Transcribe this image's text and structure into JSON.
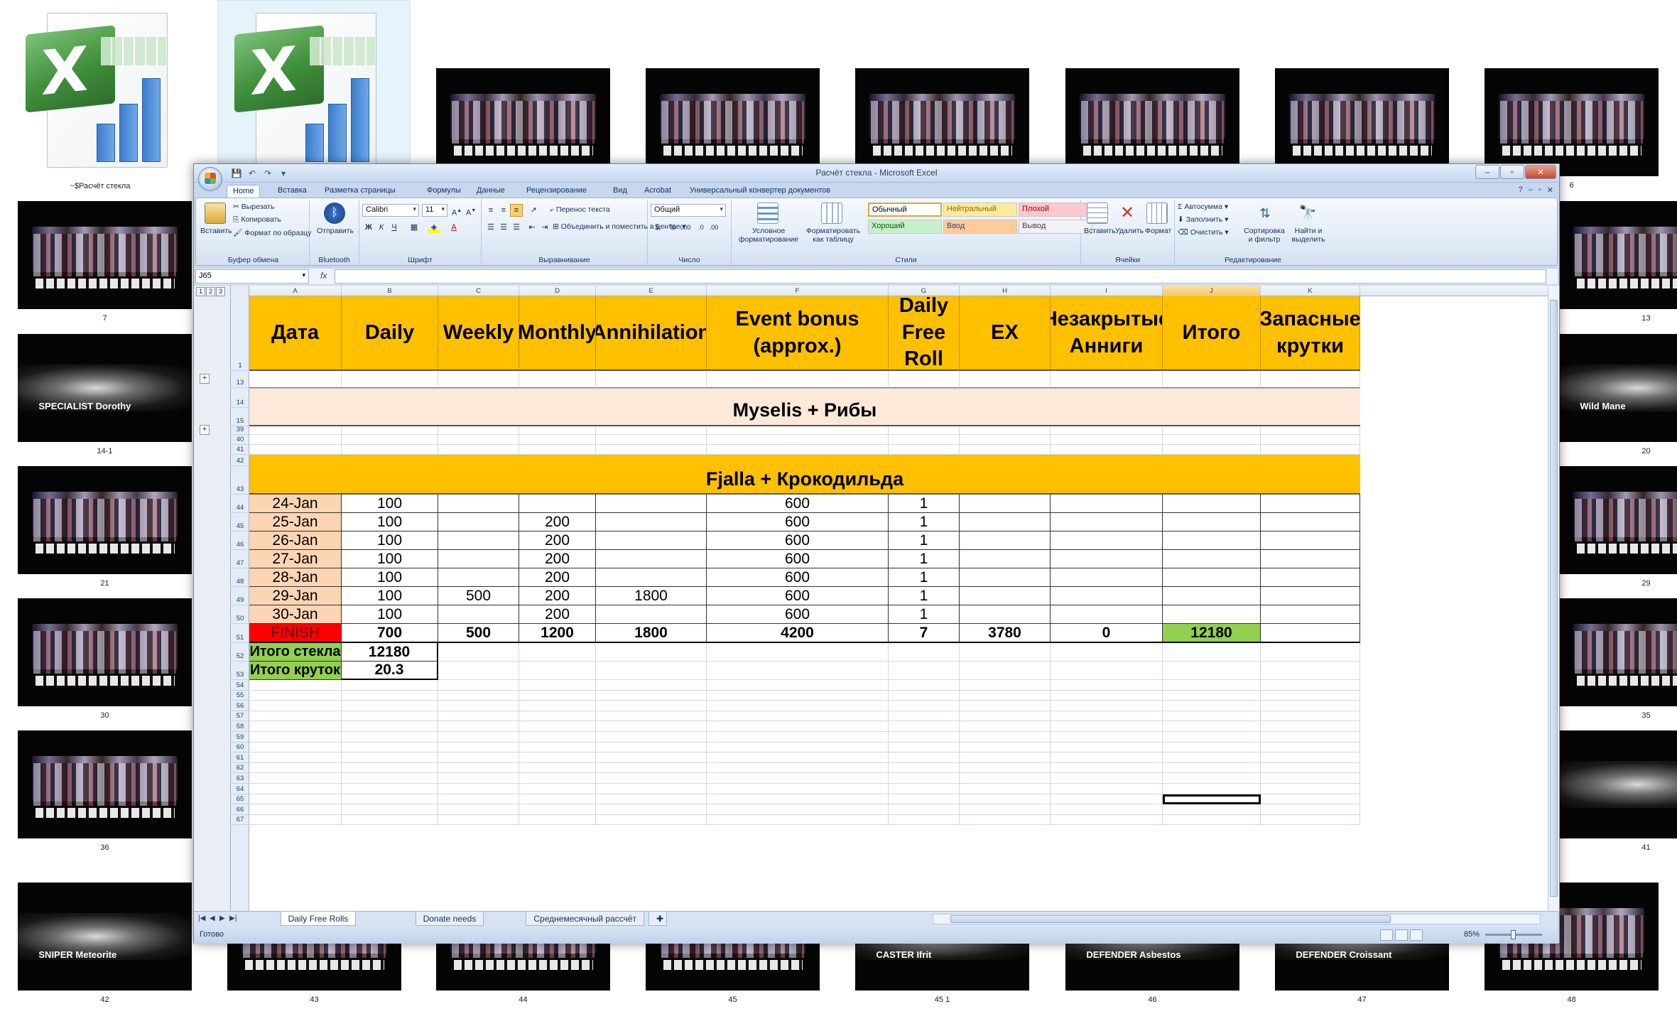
{
  "desktop": {
    "excel_files": [
      {
        "caption": "~$Расчёт стекла"
      },
      {
        "caption": ""
      }
    ],
    "thumbnails": [
      {
        "caption": "",
        "kind": "roster"
      },
      {
        "caption": "",
        "kind": "roster"
      },
      {
        "caption": "",
        "kind": "roster"
      },
      {
        "caption": "",
        "kind": "roster"
      },
      {
        "caption": "",
        "kind": "roster"
      },
      {
        "caption": "6",
        "kind": "roster"
      },
      {
        "caption": "7",
        "kind": "roster"
      },
      {
        "caption": "13",
        "kind": "roster"
      },
      {
        "caption": "14-1",
        "kind": "banner",
        "text": "SPECIALIST Dorothy"
      },
      {
        "caption": "20",
        "kind": "banner",
        "text": "Wild Mane"
      },
      {
        "caption": "21",
        "kind": "roster"
      },
      {
        "caption": "29",
        "kind": "roster"
      },
      {
        "caption": "30",
        "kind": "roster"
      },
      {
        "caption": "35",
        "kind": "roster"
      },
      {
        "caption": "36",
        "kind": "roster"
      },
      {
        "caption": "41",
        "kind": "banner",
        "text": ""
      },
      {
        "caption": "42",
        "kind": "banner",
        "text": "SNIPER Meteorite"
      },
      {
        "caption": "43",
        "kind": "roster"
      },
      {
        "caption": "44",
        "kind": "roster"
      },
      {
        "caption": "45",
        "kind": "roster"
      },
      {
        "caption": "45 1",
        "kind": "banner",
        "text": "CASTER Ifrit"
      },
      {
        "caption": "46",
        "kind": "banner",
        "text": "DEFENDER Asbestos"
      },
      {
        "caption": "47",
        "kind": "banner",
        "text": "DEFENDER Croissant"
      },
      {
        "caption": "48",
        "kind": "roster"
      }
    ]
  },
  "excel": {
    "window_title": "Расчёт стекла - Microsoft Excel",
    "tabs": [
      "Home",
      "Вставка",
      "Разметка страницы",
      "Формулы",
      "Данные",
      "Рецензирование",
      "Вид",
      "Acrobat",
      "Универсальный конвертер документов"
    ],
    "active_tab": "Home",
    "ribbon": {
      "clipboard": {
        "label": "Буфер обмена",
        "paste": "Вставить",
        "cut": "Вырезать",
        "copy": "Копировать",
        "format_painter": "Формат по образцу"
      },
      "bluetooth": {
        "label": "Bluetooth",
        "send": "Отправить"
      },
      "font": {
        "label": "Шрифт",
        "name": "Calibri",
        "size": "11"
      },
      "alignment": {
        "label": "Выравнивание",
        "wrap": "Перенос текста",
        "merge": "Объединить и поместить в центре"
      },
      "number": {
        "label": "Число",
        "format": "Общий"
      },
      "styles": {
        "label": "Стили",
        "conditional": "Условное форматирование",
        "as_table": "Форматировать как таблицу",
        "items": [
          {
            "name": "Обычный",
            "bg": "#ffffff",
            "fg": "#000000"
          },
          {
            "name": "Нейтральный",
            "bg": "#ffeb9c",
            "fg": "#9c6500"
          },
          {
            "name": "Плохой",
            "bg": "#ffc7ce",
            "fg": "#9c0006"
          },
          {
            "name": "Хороший",
            "bg": "#c6efce",
            "fg": "#006100"
          },
          {
            "name": "Ввод",
            "bg": "#ffcc99",
            "fg": "#3f3f76"
          },
          {
            "name": "Вывод",
            "bg": "#f2f2f2",
            "fg": "#3f3f3f"
          }
        ]
      },
      "cells": {
        "label": "Ячейки",
        "insert": "Вставить",
        "delete": "Удалить",
        "format": "Формат"
      },
      "editing": {
        "label": "Редактирование",
        "autosum": "Автосумма",
        "fill": "Заполнить",
        "clear": "Очистить",
        "sort": "Сортировка и фильтр",
        "find": "Найти и выделить"
      }
    },
    "name_box": "J65",
    "fx": "fx",
    "outline_levels": [
      "1",
      "2",
      "3"
    ],
    "columns": [
      "A",
      "B",
      "C",
      "D",
      "E",
      "F",
      "G",
      "H",
      "I",
      "J",
      "K"
    ],
    "selected_column": "J",
    "headers": [
      "Дата",
      "Daily",
      "Weekly",
      "Monthly",
      "Annihilation",
      "Event bonus (approx.)",
      "Daily Free Roll",
      "EX",
      "Незакрытые Анниги",
      "Итого",
      "Запасные крутки"
    ],
    "band1": "Myselis + Рибы",
    "band2": "Fjalla + Крокодильда",
    "rows": [
      {
        "n": "44",
        "cells": [
          "24-Jan",
          "100",
          "",
          "",
          "",
          "600",
          "1",
          "",
          "",
          "",
          ""
        ]
      },
      {
        "n": "45",
        "cells": [
          "25-Jan",
          "100",
          "",
          "200",
          "",
          "600",
          "1",
          "",
          "",
          "",
          ""
        ]
      },
      {
        "n": "46",
        "cells": [
          "26-Jan",
          "100",
          "",
          "200",
          "",
          "600",
          "1",
          "",
          "",
          "",
          ""
        ]
      },
      {
        "n": "47",
        "cells": [
          "27-Jan",
          "100",
          "",
          "200",
          "",
          "600",
          "1",
          "",
          "",
          "",
          ""
        ]
      },
      {
        "n": "48",
        "cells": [
          "28-Jan",
          "100",
          "",
          "200",
          "",
          "600",
          "1",
          "",
          "",
          "",
          ""
        ]
      },
      {
        "n": "49",
        "cells": [
          "29-Jan",
          "100",
          "500",
          "200",
          "1800",
          "600",
          "1",
          "",
          "",
          "",
          ""
        ]
      },
      {
        "n": "50",
        "cells": [
          "30-Jan",
          "100",
          "",
          "200",
          "",
          "600",
          "1",
          "",
          "",
          "",
          ""
        ]
      }
    ],
    "finish_row": {
      "n": "51",
      "cells": [
        "FINISH",
        "700",
        "500",
        "1200",
        "1800",
        "4200",
        "7",
        "3780",
        "0",
        "12180",
        ""
      ]
    },
    "summary": [
      {
        "n": "52",
        "label": "Итого стекла",
        "value": "12180"
      },
      {
        "n": "53",
        "label": "Итого круток",
        "value": "20.3"
      }
    ],
    "empty_rows": [
      "54",
      "55",
      "56",
      "57",
      "58",
      "59",
      "60",
      "61",
      "62",
      "63",
      "64",
      "65",
      "66",
      "67"
    ],
    "sheet_tabs": [
      "Daily Free Rolls",
      "Donate needs",
      "Среднемесячный рассчёт"
    ],
    "active_sheet": "Daily Free Rolls",
    "status": "Готово",
    "zoom": "85%"
  }
}
